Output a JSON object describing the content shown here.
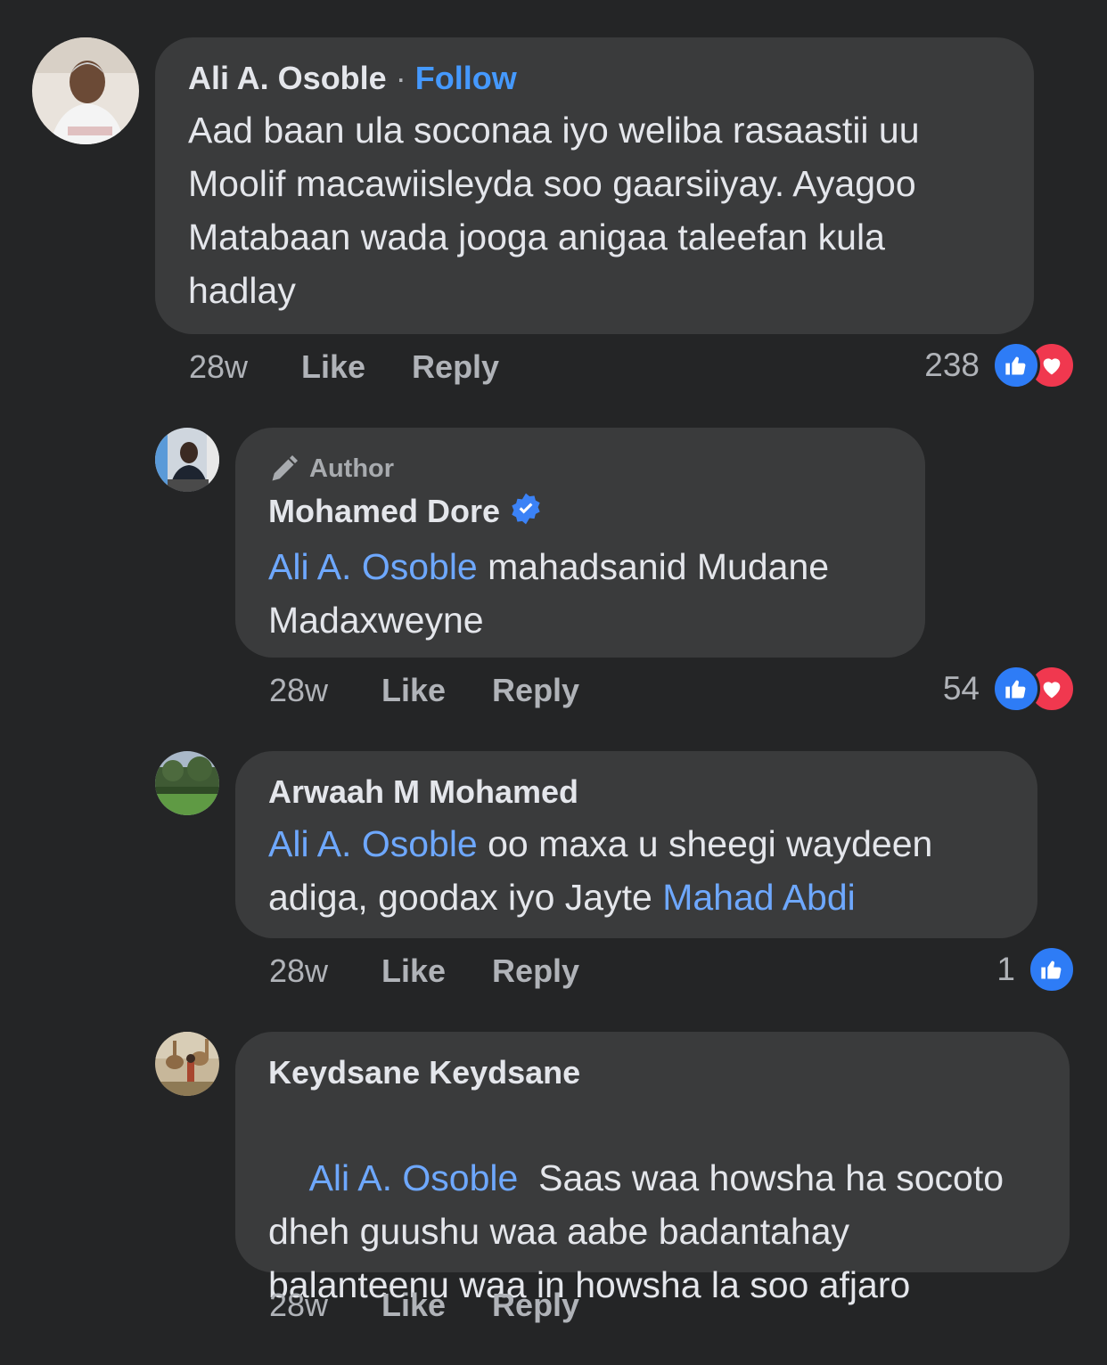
{
  "comments": [
    {
      "name": "Ali A. Osoble",
      "separator": "·",
      "follow_label": "Follow",
      "text": "Aad baan ula soconaa iyo weliba rasaastii uu Moolif macawiisleyda soo gaarsiiyay. Ayagoo Matabaan wada jooga anigaa taleefan kula hadlay",
      "time": "28w",
      "like_label": "Like",
      "reply_label": "Reply",
      "reaction_count": "238",
      "reactions": [
        "like-icon",
        "love-icon"
      ]
    },
    {
      "badge": "Author",
      "name": "Mohamed Dore",
      "verified": true,
      "mention": "Ali A. Osoble",
      "text": " mahadsanid Mudane Madaxweyne",
      "time": "28w",
      "like_label": "Like",
      "reply_label": "Reply",
      "reaction_count": "54",
      "reactions": [
        "like-icon",
        "love-icon"
      ]
    },
    {
      "name": "Arwaah M Mohamed",
      "mention": "Ali A. Osoble",
      "text": " oo maxa u sheegi waydeen adiga, goodax iyo Jayte ",
      "mention2": "Mahad Abdi",
      "time": "28w",
      "like_label": "Like",
      "reply_label": "Reply",
      "reaction_count": "1",
      "reactions": [
        "like-icon"
      ]
    },
    {
      "name": "Keydsane Keydsane",
      "mention": "Ali A. Osoble",
      "text": "  Saas waa howsha ha socoto dheh guushu waa aabe badantahay balanteenu waa in howsha la soo afjaro",
      "time": "28w",
      "like_label": "Like",
      "reply_label": "Reply"
    }
  ],
  "colors": {
    "background": "#242526",
    "bubble": "#3a3b3c",
    "mention": "#6ea8ff",
    "follow": "#4599ff",
    "like": "#2e7cf6",
    "love": "#f0384f"
  }
}
